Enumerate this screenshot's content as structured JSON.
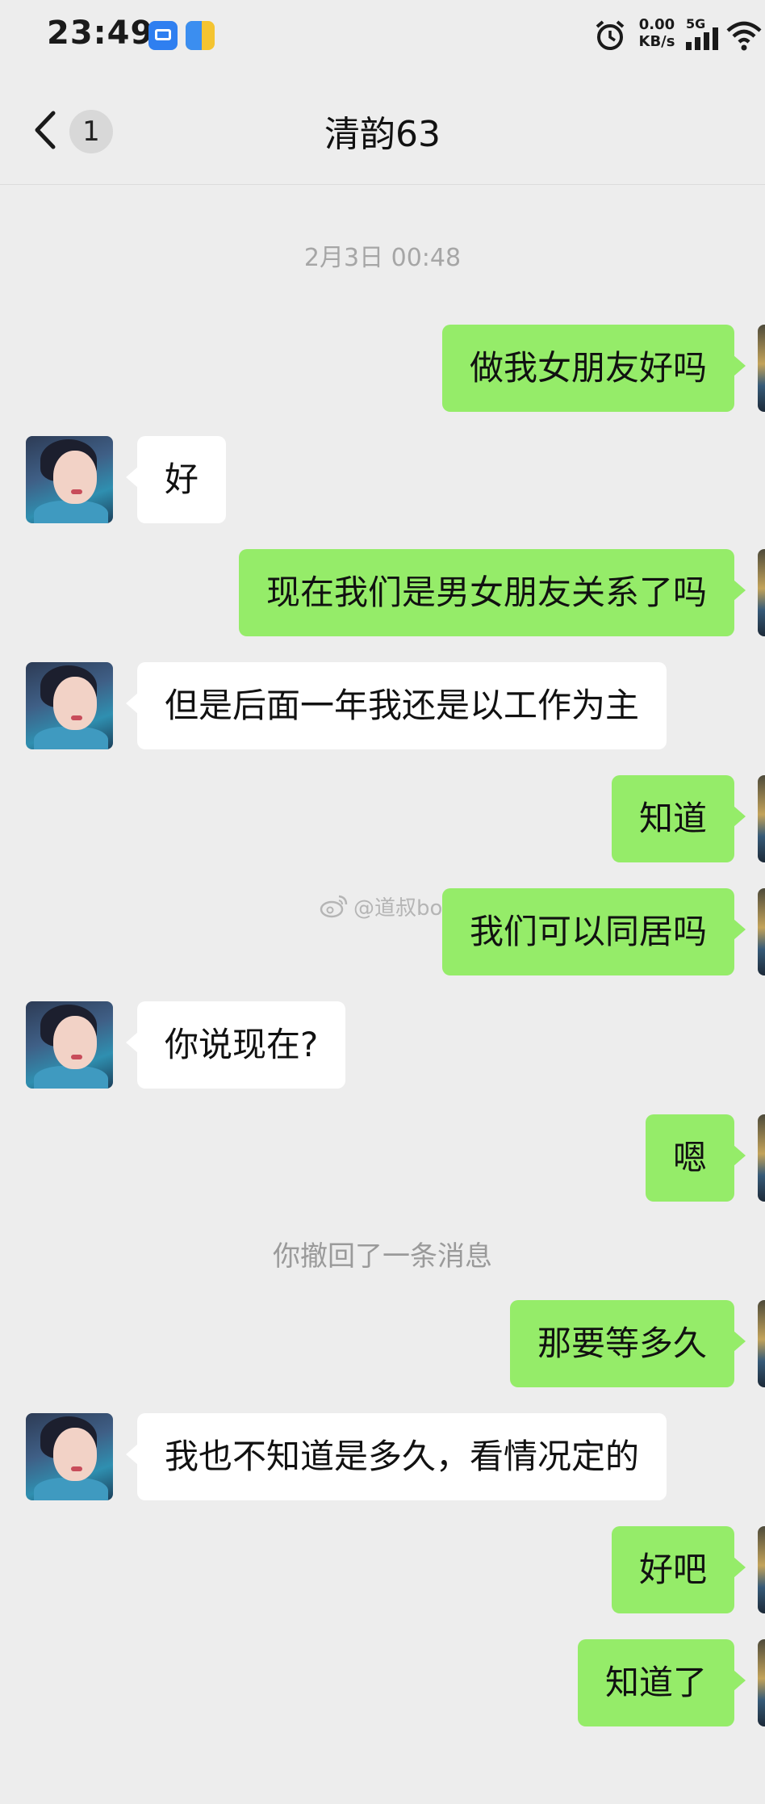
{
  "status_bar": {
    "time": "23:49",
    "net_speed_value": "0.00",
    "net_speed_unit": "KB/s",
    "network_type": "5G"
  },
  "header": {
    "unread_count": "1",
    "chat_title": "清韵63"
  },
  "chat": {
    "timestamp_1": "2月3日 00:48",
    "messages": [
      {
        "sender": "me",
        "text": "做我女朋友好吗"
      },
      {
        "sender": "them",
        "text": "好"
      },
      {
        "sender": "me",
        "text": "现在我们是男女朋友关系了吗"
      },
      {
        "sender": "them",
        "text": "但是后面一年我还是以工作为主"
      },
      {
        "sender": "me",
        "text": "知道"
      },
      {
        "sender": "me",
        "text": "我们可以同居吗"
      },
      {
        "sender": "them",
        "text": "你说现在?"
      },
      {
        "sender": "me",
        "text": "嗯"
      },
      {
        "sender": "me",
        "text": "那要等多久"
      },
      {
        "sender": "them",
        "text": "我也不知道是多久，看情况定的"
      },
      {
        "sender": "me",
        "text": "好吧"
      },
      {
        "sender": "me",
        "text": "知道了"
      }
    ],
    "recall_notice": "你撤回了一条消息",
    "watermark": "@道叔bot"
  },
  "colors": {
    "background": "#ededed",
    "my_bubble": "#95ec69",
    "their_bubble": "#ffffff"
  },
  "icons": [
    "back-chevron-icon",
    "alarm-icon",
    "signal-icon",
    "wifi-icon",
    "weibo-icon"
  ]
}
